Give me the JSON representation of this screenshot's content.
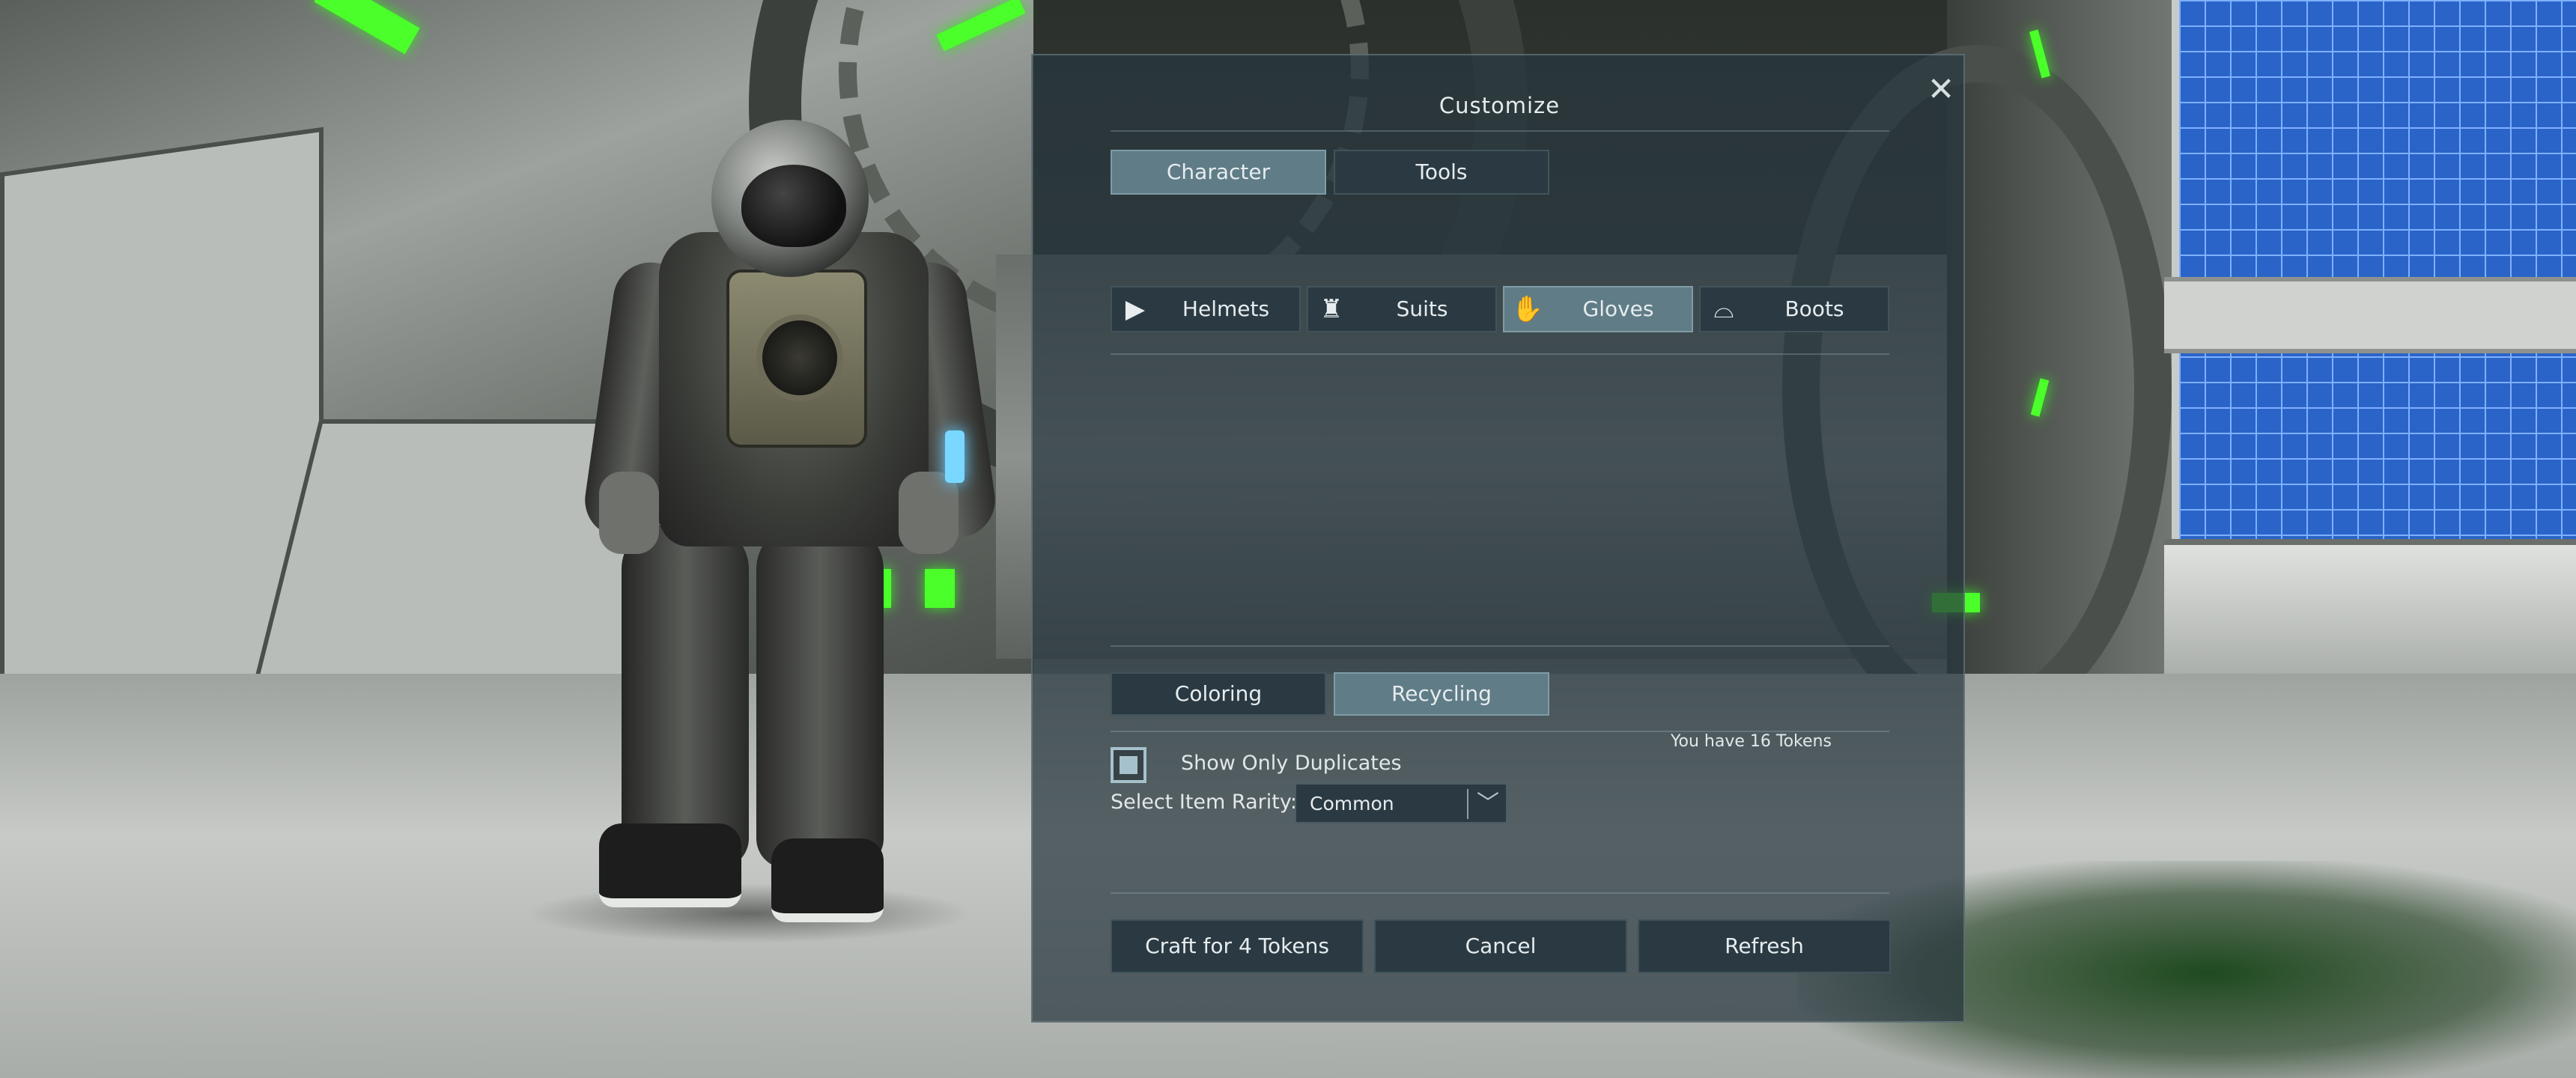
{
  "dialog": {
    "title": "Customize",
    "close_icon": "close-icon"
  },
  "main_tabs": [
    {
      "label": "Character",
      "active": true
    },
    {
      "label": "Tools",
      "active": false
    }
  ],
  "categories": [
    {
      "label": "Helmets",
      "icon": "helmet-icon",
      "glyph": "▶",
      "active": false
    },
    {
      "label": "Suits",
      "icon": "suit-icon",
      "glyph": "♜",
      "active": false
    },
    {
      "label": "Gloves",
      "icon": "glove-icon",
      "glyph": "✋",
      "active": true
    },
    {
      "label": "Boots",
      "icon": "boot-icon",
      "glyph": "⌓",
      "active": false
    }
  ],
  "sub_tabs": [
    {
      "label": "Coloring",
      "active": false
    },
    {
      "label": "Recycling",
      "active": true
    }
  ],
  "recycling": {
    "tokens_text": "You have 16 Tokens",
    "show_duplicates_label": "Show Only Duplicates",
    "show_duplicates_checked": true,
    "rarity_label": "Select Item Rarity:",
    "rarity_value": "Common"
  },
  "actions": {
    "craft": "Craft for 4 Tokens",
    "cancel": "Cancel",
    "refresh": "Refresh"
  },
  "colors": {
    "active_tab": "#5f7c87",
    "button": "#2b3a42",
    "accent_green": "#4bff2a"
  }
}
